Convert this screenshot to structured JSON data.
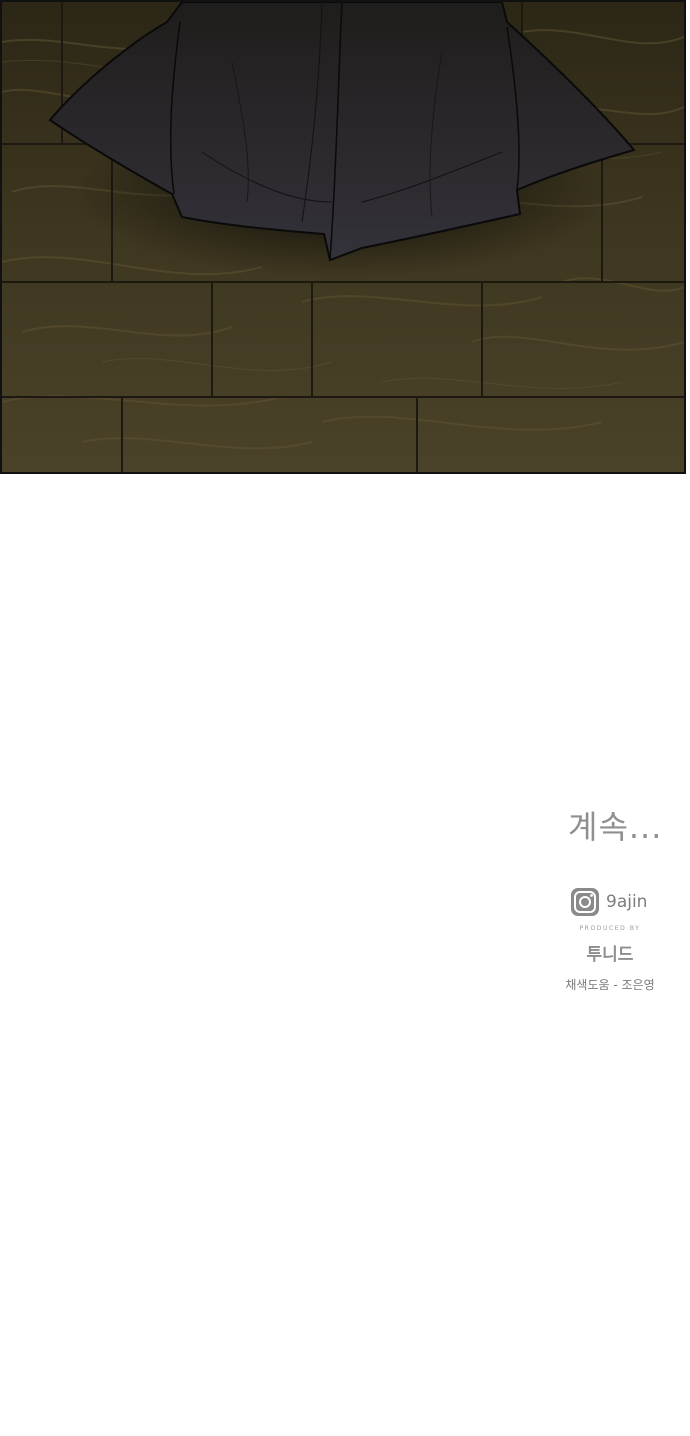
{
  "ending": {
    "continued_text": "계속...",
    "instagram_handle": "9ajin",
    "produced_by": "PRODUCED BY",
    "studio_logo_text": "투니드",
    "credit_text": "채색도움 - 조은영"
  },
  "colors": {
    "floor_dark": "#2f2a18",
    "floor_mid": "#4a4128",
    "floor_light": "#6a5d3a",
    "robe": "#2a2826",
    "text_gray": "#8f8f8f"
  },
  "icons": {
    "instagram": "instagram-icon"
  }
}
